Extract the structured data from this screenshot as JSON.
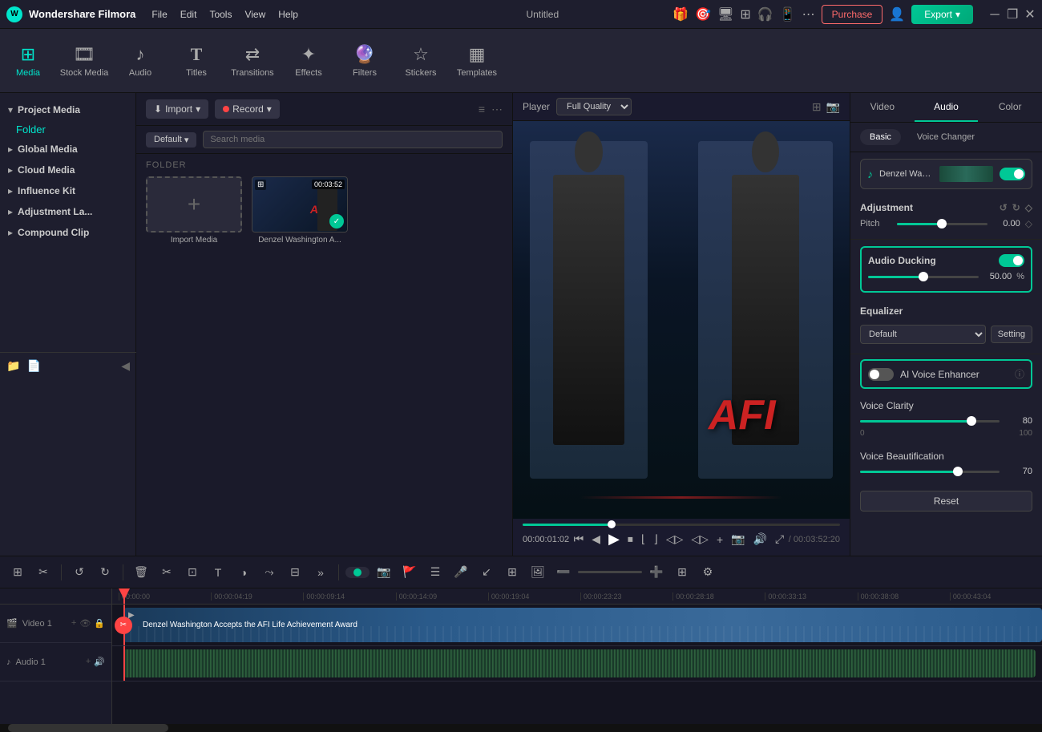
{
  "app": {
    "name": "Wondershare Filmora",
    "title": "Untitled",
    "logo": "W"
  },
  "menu": {
    "items": [
      "File",
      "Edit",
      "Tools",
      "View",
      "Help"
    ]
  },
  "toolbar": {
    "items": [
      {
        "id": "media",
        "label": "Media",
        "icon": "🎬"
      },
      {
        "id": "stock-media",
        "label": "Stock Media",
        "icon": "📦"
      },
      {
        "id": "audio",
        "label": "Audio",
        "icon": "🎵"
      },
      {
        "id": "titles",
        "label": "Titles",
        "icon": "T"
      },
      {
        "id": "transitions",
        "label": "Transitions",
        "icon": "⟷"
      },
      {
        "id": "effects",
        "label": "Effects",
        "icon": "✨"
      },
      {
        "id": "filters",
        "label": "Filters",
        "icon": "🎨"
      },
      {
        "id": "stickers",
        "label": "Stickers",
        "icon": "⭐"
      },
      {
        "id": "templates",
        "label": "Templates",
        "icon": "▦"
      }
    ],
    "active": "media"
  },
  "header_right": {
    "purchase": "Purchase",
    "export": "Export"
  },
  "left_panel": {
    "sections": [
      {
        "id": "project-media",
        "label": "Project Media",
        "expanded": true
      },
      {
        "id": "global-media",
        "label": "Global Media"
      },
      {
        "id": "cloud-media",
        "label": "Cloud Media"
      },
      {
        "id": "influence-kit",
        "label": "Influence Kit"
      },
      {
        "id": "adjustment-layers",
        "label": "Adjustment La..."
      },
      {
        "id": "compound-clip",
        "label": "Compound Clip"
      }
    ],
    "active_folder": "Folder"
  },
  "media_panel": {
    "import_label": "Import",
    "record_label": "Record",
    "default_label": "Default",
    "search_placeholder": "Search media",
    "folder_header": "FOLDER",
    "import_media_label": "Import Media",
    "clip_name": "Denzel Washington A...",
    "clip_duration": "00:03:52",
    "filter_icon": "⚙",
    "more_icon": "···"
  },
  "preview": {
    "player_label": "Player",
    "quality": "Full Quality",
    "current_time": "00:00:01:02",
    "total_time": "00:03:52:20",
    "progress_pct": 28
  },
  "right_panel": {
    "tabs": [
      "Video",
      "Audio",
      "Color"
    ],
    "active_tab": "Audio",
    "sub_tabs": [
      "Basic",
      "Voice Changer"
    ],
    "active_sub": "Basic",
    "track_name": "Denzel Washington ...",
    "adjustment_label": "Adjustment",
    "pitch_label": "Pitch",
    "pitch_value": "0.00",
    "audio_ducking_label": "Audio Ducking",
    "ducking_value": "50.00",
    "ducking_pct": "%",
    "ducking_fill_pct": 50,
    "equalizer_label": "Equalizer",
    "eq_default": "Default",
    "setting_label": "Setting",
    "ai_voice_label": "AI Voice Enhancer",
    "voice_clarity_label": "Voice Clarity",
    "voice_clarity_value": 80,
    "voice_clarity_min": "0",
    "voice_clarity_max": "100",
    "voice_beautification_label": "Voice Beautification",
    "voice_beauty_value": 70,
    "reset_label": "Reset"
  },
  "timeline": {
    "ruler_marks": [
      "00:00:00",
      "00:00:04:19",
      "00:00:09:14",
      "00:00:14:09",
      "00:00:19:04",
      "00:00:23:23",
      "00:00:28:18",
      "00:00:33:13",
      "00:00:38:08",
      "00:00:43:04"
    ],
    "video_clip_label": "Denzel Washington Accepts the AFI Life Achievement Award",
    "video_track_label": "Video 1",
    "audio_track_label": "Audio 1"
  }
}
